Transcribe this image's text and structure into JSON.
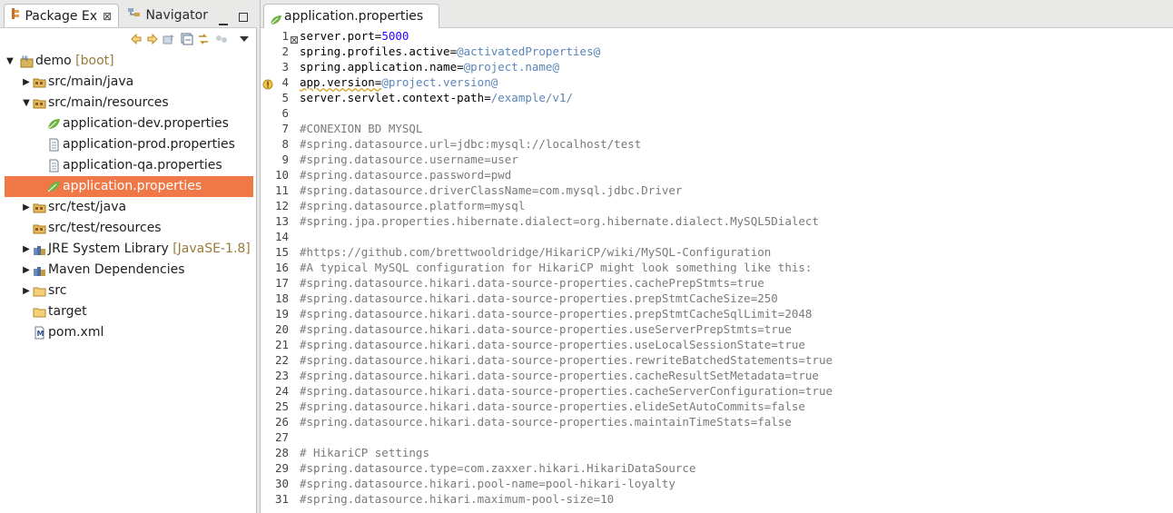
{
  "left_panel": {
    "tabs": [
      {
        "label": "Package Ex",
        "close": "⊠"
      },
      {
        "label": "Navigator",
        "close": "⊠"
      }
    ],
    "tree": [
      {
        "label": "demo",
        "decoration": "[boot]",
        "indent": 0,
        "expanded": true,
        "icon": "project-icon"
      },
      {
        "label": "src/main/java",
        "indent": 1,
        "expanded": false,
        "icon": "source-folder-icon"
      },
      {
        "label": "src/main/resources",
        "indent": 1,
        "expanded": true,
        "icon": "source-folder-icon"
      },
      {
        "label": "application-dev.properties",
        "indent": 2,
        "icon": "spring-leaf-icon"
      },
      {
        "label": "application-prod.properties",
        "indent": 2,
        "icon": "file-icon"
      },
      {
        "label": "application-qa.properties",
        "indent": 2,
        "icon": "file-icon"
      },
      {
        "label": "application.properties",
        "indent": 2,
        "icon": "spring-leaf-icon",
        "selected": true
      },
      {
        "label": "src/test/java",
        "indent": 1,
        "expanded": false,
        "icon": "source-folder-icon"
      },
      {
        "label": "src/test/resources",
        "indent": 1,
        "icon": "source-folder-icon"
      },
      {
        "label": "JRE System Library",
        "decoration": "[JavaSE-1.8]",
        "indent": 1,
        "expanded": false,
        "icon": "library-icon"
      },
      {
        "label": "Maven Dependencies",
        "indent": 1,
        "expanded": false,
        "icon": "library-icon"
      },
      {
        "label": "src",
        "indent": 1,
        "expanded": false,
        "icon": "folder-icon"
      },
      {
        "label": "target",
        "indent": 1,
        "icon": "folder-icon"
      },
      {
        "label": "pom.xml",
        "indent": 1,
        "icon": "maven-file-icon"
      }
    ]
  },
  "editor": {
    "tab": {
      "label": "application.properties",
      "close": "⊠"
    },
    "lines": [
      {
        "n": "1",
        "key": "server.port=",
        "val": "5000",
        "vc": "v"
      },
      {
        "n": "2",
        "key": "spring.profiles.active=",
        "val": "@activatedProperties@",
        "vc": "v2"
      },
      {
        "n": "3",
        "key": "spring.application.name=",
        "val": "@project.name@",
        "vc": "v2"
      },
      {
        "n": "4",
        "key": "app.version=",
        "val": "@project.version@",
        "vc": "v2",
        "warn": true
      },
      {
        "n": "5",
        "key": "server.servlet.context-path=",
        "val": "/example/v1/",
        "vc": "v2"
      },
      {
        "n": "6",
        "comment": ""
      },
      {
        "n": "7",
        "comment": "#CONEXION BD MYSQL"
      },
      {
        "n": "8",
        "comment": "#spring.datasource.url=jdbc:mysql://localhost/test"
      },
      {
        "n": "9",
        "comment": "#spring.datasource.username=user"
      },
      {
        "n": "10",
        "comment": "#spring.datasource.password=pwd"
      },
      {
        "n": "11",
        "comment": "#spring.datasource.driverClassName=com.mysql.jdbc.Driver"
      },
      {
        "n": "12",
        "comment": "#spring.datasource.platform=mysql"
      },
      {
        "n": "13",
        "comment": "#spring.jpa.properties.hibernate.dialect=org.hibernate.dialect.MySQL5Dialect"
      },
      {
        "n": "14",
        "comment": ""
      },
      {
        "n": "15",
        "comment": "#https://github.com/brettwooldridge/HikariCP/wiki/MySQL-Configuration"
      },
      {
        "n": "16",
        "comment": "#A typical MySQL configuration for HikariCP might look something like this:"
      },
      {
        "n": "17",
        "comment": "#spring.datasource.hikari.data-source-properties.cachePrepStmts=true"
      },
      {
        "n": "18",
        "comment": "#spring.datasource.hikari.data-source-properties.prepStmtCacheSize=250"
      },
      {
        "n": "19",
        "comment": "#spring.datasource.hikari.data-source-properties.prepStmtCacheSqlLimit=2048"
      },
      {
        "n": "20",
        "comment": "#spring.datasource.hikari.data-source-properties.useServerPrepStmts=true"
      },
      {
        "n": "21",
        "comment": "#spring.datasource.hikari.data-source-properties.useLocalSessionState=true"
      },
      {
        "n": "22",
        "comment": "#spring.datasource.hikari.data-source-properties.rewriteBatchedStatements=true"
      },
      {
        "n": "23",
        "comment": "#spring.datasource.hikari.data-source-properties.cacheResultSetMetadata=true"
      },
      {
        "n": "24",
        "comment": "#spring.datasource.hikari.data-source-properties.cacheServerConfiguration=true"
      },
      {
        "n": "25",
        "comment": "#spring.datasource.hikari.data-source-properties.elideSetAutoCommits=false"
      },
      {
        "n": "26",
        "comment": "#spring.datasource.hikari.data-source-properties.maintainTimeStats=false"
      },
      {
        "n": "27",
        "comment": ""
      },
      {
        "n": "28",
        "comment": "# HikariCP settings"
      },
      {
        "n": "29",
        "comment": "#spring.datasource.type=com.zaxxer.hikari.HikariDataSource"
      },
      {
        "n": "30",
        "comment": "#spring.datasource.hikari.pool-name=pool-hikari-loyalty"
      },
      {
        "n": "31",
        "comment": "#spring.datasource.hikari.maximum-pool-size=10"
      }
    ]
  },
  "colors": {
    "selection": "#f07746",
    "comment": "#7a7a7a",
    "value_number": "#2a00ff",
    "value_placeholder": "#5a85b8"
  }
}
